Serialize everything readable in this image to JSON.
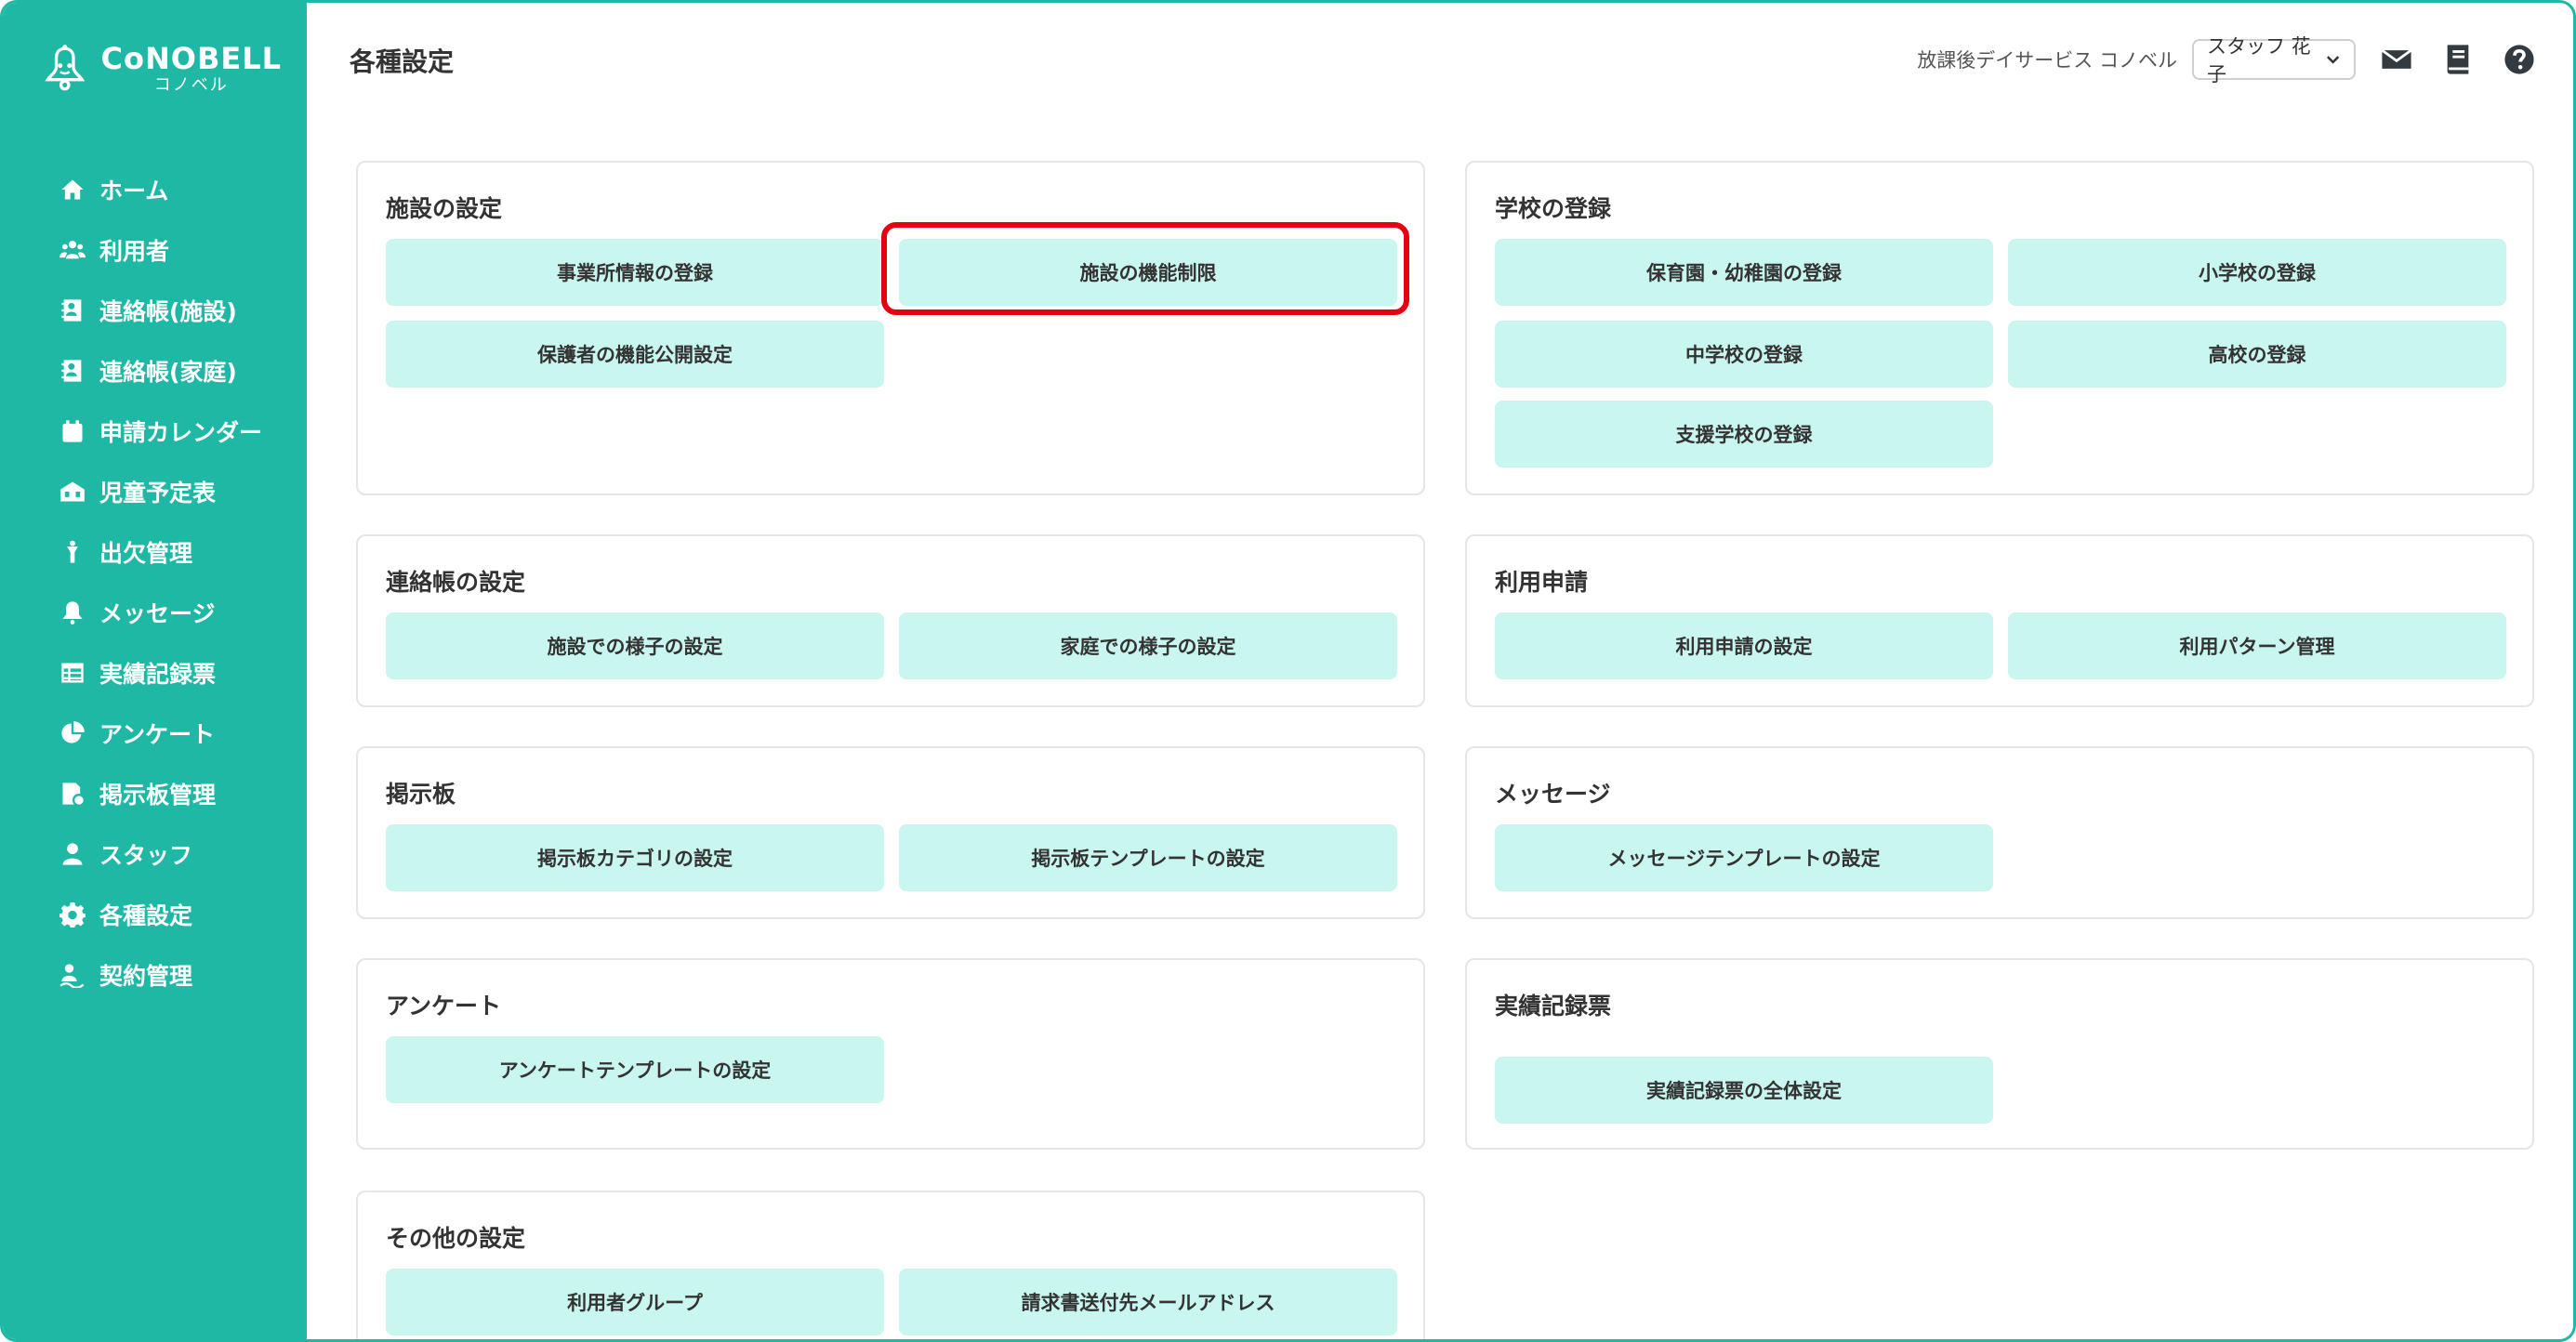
{
  "brand": {
    "name": "CoNOBELL",
    "sub": "コノベル"
  },
  "sidebar": {
    "items": [
      {
        "label": "ホーム",
        "icon": "home-icon"
      },
      {
        "label": "利用者",
        "icon": "users-icon"
      },
      {
        "label": "連絡帳(施設)",
        "icon": "contact-book-icon"
      },
      {
        "label": "連絡帳(家庭)",
        "icon": "contact-book-icon"
      },
      {
        "label": "申請カレンダー",
        "icon": "calendar-icon"
      },
      {
        "label": "児童予定表",
        "icon": "schedule-icon"
      },
      {
        "label": "出欠管理",
        "icon": "person-icon"
      },
      {
        "label": "メッセージ",
        "icon": "bell-icon"
      },
      {
        "label": "実績記録票",
        "icon": "table-icon"
      },
      {
        "label": "アンケート",
        "icon": "pie-chart-icon"
      },
      {
        "label": "掲示板管理",
        "icon": "board-icon"
      },
      {
        "label": "スタッフ",
        "icon": "staff-icon"
      },
      {
        "label": "各種設定",
        "icon": "gear-icon"
      },
      {
        "label": "契約管理",
        "icon": "contract-icon"
      }
    ]
  },
  "header": {
    "title": "各種設定",
    "facility": "放課後デイサービス コノベル",
    "user": "スタッフ 花子"
  },
  "sections": {
    "facility": {
      "title": "施設の設定",
      "buttons": [
        "事業所情報の登録",
        "施設の機能制限",
        "保護者の機能公開設定"
      ]
    },
    "school": {
      "title": "学校の登録",
      "buttons": [
        "保育園・幼稚園の登録",
        "小学校の登録",
        "中学校の登録",
        "高校の登録",
        "支援学校の登録"
      ]
    },
    "contact": {
      "title": "連絡帳の設定",
      "buttons": [
        "施設での様子の設定",
        "家庭での様子の設定"
      ]
    },
    "usage": {
      "title": "利用申請",
      "buttons": [
        "利用申請の設定",
        "利用パターン管理"
      ]
    },
    "board": {
      "title": "掲示板",
      "buttons": [
        "掲示板カテゴリの設定",
        "掲示板テンプレートの設定"
      ]
    },
    "message": {
      "title": "メッセージ",
      "buttons": [
        "メッセージテンプレートの設定"
      ]
    },
    "survey": {
      "title": "アンケート",
      "buttons": [
        "アンケートテンプレートの設定"
      ]
    },
    "record": {
      "title": "実績記録票",
      "buttons": [
        "実績記録票の全体設定"
      ]
    },
    "other": {
      "title": "その他の設定",
      "buttons": [
        "利用者グループ",
        "請求書送付先メールアドレス"
      ]
    }
  },
  "colors": {
    "accent": "#1fb8a5",
    "button_bg": "#c9f6ee",
    "highlight": "#e50012"
  }
}
